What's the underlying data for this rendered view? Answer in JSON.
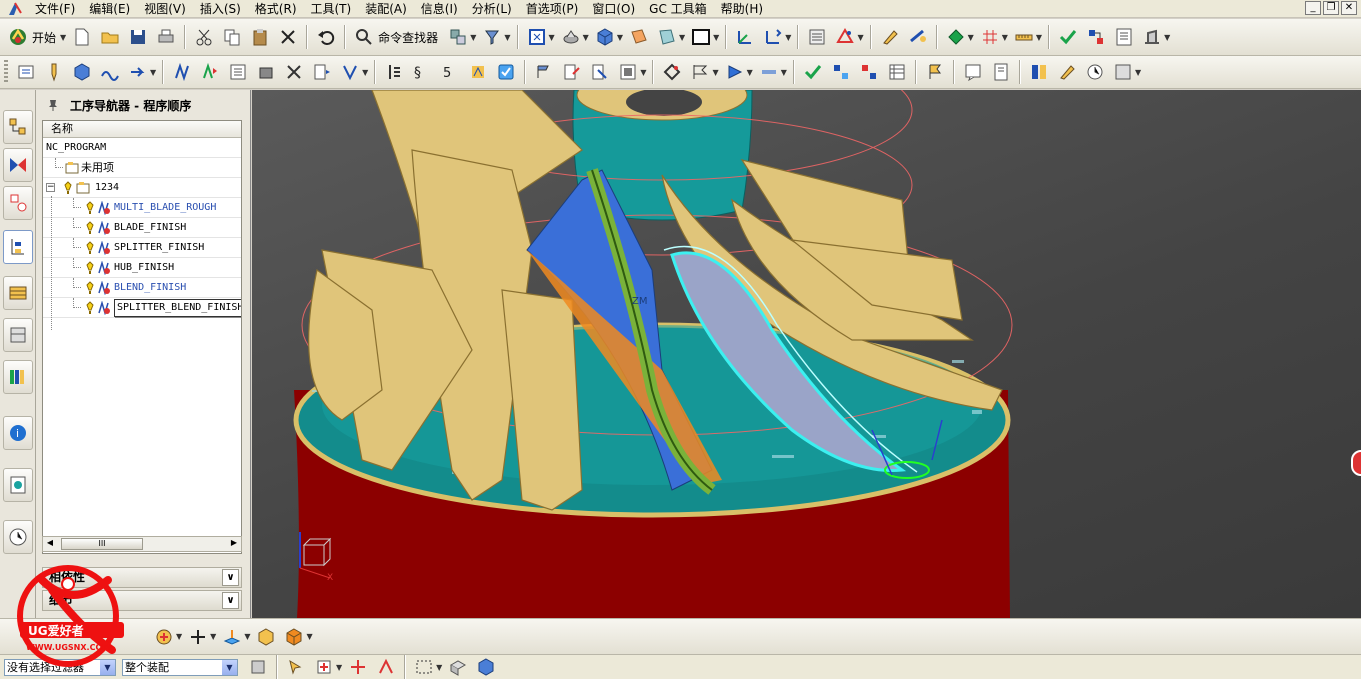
{
  "menu": {
    "items": [
      "文件(F)",
      "编辑(E)",
      "视图(V)",
      "插入(S)",
      "格式(R)",
      "工具(T)",
      "装配(A)",
      "信息(I)",
      "分析(L)",
      "首选项(P)",
      "窗口(O)",
      "GC 工具箱",
      "帮助(H)"
    ]
  },
  "toolbar": {
    "start_label": "开始",
    "command_finder_label": "命令查找器"
  },
  "navigator": {
    "title": "工序导航器 - 程序顺序",
    "column_name": "名称",
    "root": "NC_PROGRAM",
    "unused": "未用项",
    "group": "1234",
    "operations": [
      {
        "name": "MULTI_BLADE_ROUGH"
      },
      {
        "name": "BLADE_FINISH"
      },
      {
        "name": "SPLITTER_FINISH"
      },
      {
        "name": "HUB_FINISH"
      },
      {
        "name": "BLEND_FINISH"
      },
      {
        "name": "SPLITTER_BLEND_FINISH"
      }
    ],
    "scroll_thumb_label": "III",
    "section_dependencies": "相依性",
    "section_details": "细节"
  },
  "viewport": {
    "axis_label": "ZM",
    "triad_x_label": "X"
  },
  "status": {
    "filter_value": "没有选择过滤器",
    "scope_value": "整个装配"
  },
  "watermark": {
    "brand_text": "UG爱好者",
    "url_text": "WWW.UGSNX.COM"
  },
  "colors": {
    "viewport_bg": "#444444",
    "blade_gold": "#e0c57a",
    "hub_teal": "#138c8c",
    "stock_red": "#8c0000",
    "selected_blade": "#3a6fd8"
  }
}
